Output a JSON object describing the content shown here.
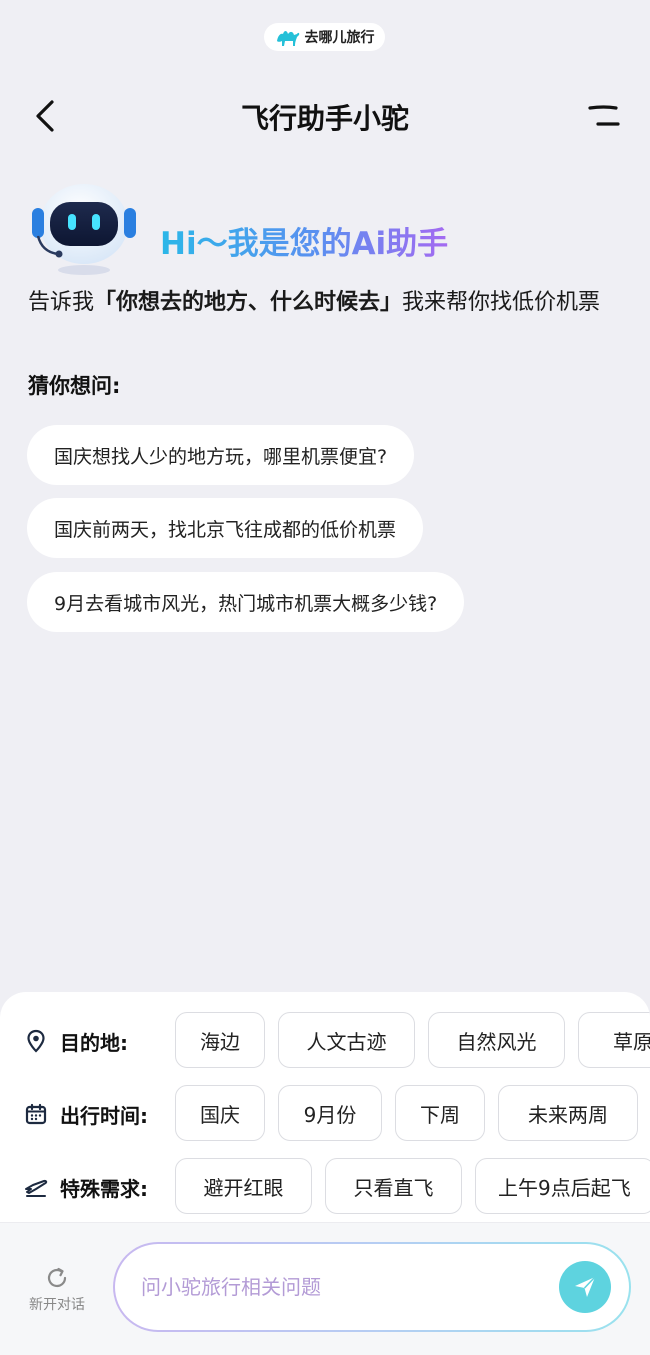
{
  "brand": {
    "name": "去哪儿旅行"
  },
  "nav": {
    "title": "飞行助手小驼"
  },
  "hero": {
    "greeting": "Hi～我是您的Ai助手",
    "intro_prefix": "告诉我",
    "intro_bold": "「你想去的地方、什么时候去」",
    "intro_suffix": "我来帮你找低价机票"
  },
  "guess": {
    "label": "猜你想问:",
    "items": [
      "国庆想找人少的地方玩，哪里机票便宜?",
      "国庆前两天，找北京飞往成都的低价机票",
      "9月去看城市风光，热门城市机票大概多少钱?"
    ]
  },
  "filters": [
    {
      "label": "目的地:",
      "icon": "location-pin-icon",
      "chips": [
        "海边",
        "人文古迹",
        "自然风光",
        "草原"
      ]
    },
    {
      "label": "出行时间:",
      "icon": "calendar-icon",
      "chips": [
        "国庆",
        "9月份",
        "下周",
        "未来两周"
      ]
    },
    {
      "label": "特殊需求:",
      "icon": "plane-ticket-icon",
      "chips": [
        "避开红眼",
        "只看直飞",
        "上午9点后起飞"
      ]
    }
  ],
  "bottom": {
    "new_chat_label": "新开对话",
    "input_placeholder": "问小驼旅行相关问题"
  },
  "colors": {
    "background": "#efeff4",
    "accent": "#5ed3df",
    "greeting_gradient": [
      "#2bb7e8",
      "#a46af1"
    ]
  }
}
